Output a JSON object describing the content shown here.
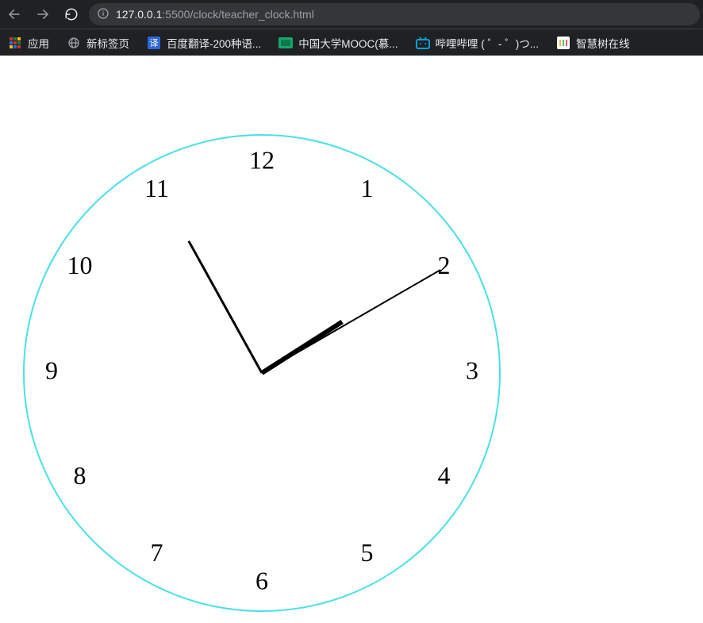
{
  "browser": {
    "url_host": "127.0.0.1",
    "url_port": ":5500",
    "url_path": "/clock/teacher_clock.html",
    "nav": {
      "back_enabled": false,
      "forward_enabled": false
    }
  },
  "bookmarks": {
    "apps_label": "应用",
    "items": [
      {
        "label": "新标签页",
        "icon": "globe",
        "icon_color": "#9aa0a6"
      },
      {
        "label": "百度翻译-200种语...",
        "icon": "baidu-yi",
        "icon_color": "#2b68d9"
      },
      {
        "label": "中国大学MOOC(慕...",
        "icon": "mooc",
        "icon_color": "#18a66b"
      },
      {
        "label": "哔哩哔哩 (  ゜- ゜)つ...",
        "icon": "bilibili",
        "icon_color": "#00a1d6"
      },
      {
        "label": "智慧树在线",
        "icon": "zhihuishu",
        "icon_color": "#ffffff"
      }
    ]
  },
  "clock": {
    "numbers": [
      "12",
      "1",
      "2",
      "3",
      "4",
      "5",
      "6",
      "7",
      "8",
      "9",
      "10",
      "11"
    ],
    "ring_color": "#4ae0e8",
    "time": {
      "hour": 1,
      "minute": 55,
      "second": 10
    }
  }
}
